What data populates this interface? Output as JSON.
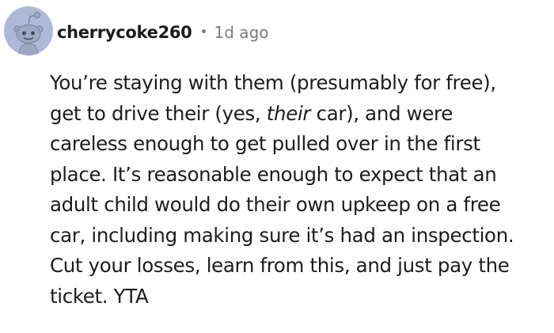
{
  "comment": {
    "author": "cherrycoke260",
    "separator": "•",
    "time_ago": "1d ago",
    "avatar_icon": "reddit-snoo-avatar-icon",
    "avatar_bg": "#aeb8d9",
    "lines": {
      "l1": "You’re staying with them (presumably for free),",
      "l2a": "get to drive their (yes, ",
      "l2b": "their",
      "l2c": " car), and were",
      "l3": "careless enough to get pulled over in the first",
      "l4": "place. It’s reasonable enough to expect that an",
      "l5": "adult child would do their own upkeep on a free",
      "l6": "car, including making sure it’s had an inspection.",
      "l7": "Cut your losses, learn from this, and just pay the",
      "l8": "ticket. YTA"
    }
  }
}
